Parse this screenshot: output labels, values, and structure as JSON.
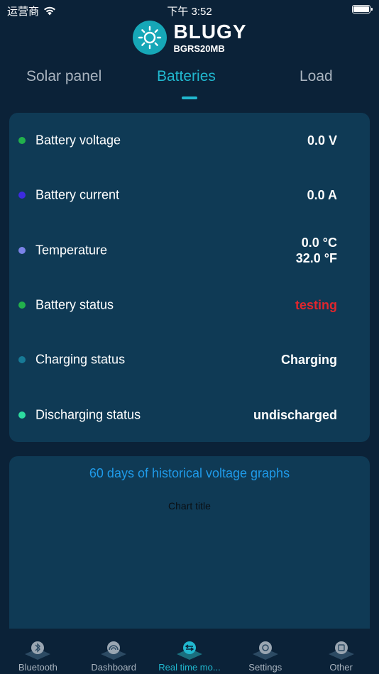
{
  "status_bar": {
    "carrier": "运营商",
    "time": "下午 3:52"
  },
  "brand": {
    "name": "BLUGY",
    "model": "BGRS20MB"
  },
  "tabs": [
    {
      "label": "Solar panel",
      "active": false
    },
    {
      "label": "Batteries",
      "active": true
    },
    {
      "label": "Load",
      "active": false
    }
  ],
  "metrics": [
    {
      "label": "Battery voltage",
      "value": "0.0 V",
      "dot_color": "#22b14c",
      "value_color": "#ffffff"
    },
    {
      "label": "Battery current",
      "value": "0.0 A",
      "dot_color": "#3d2be0",
      "value_color": "#ffffff"
    },
    {
      "label": "Temperature",
      "value": "0.0 °C",
      "value2": "32.0 °F",
      "dot_color": "#7b83e8",
      "value_color": "#ffffff"
    },
    {
      "label": "Battery status",
      "value": "testing",
      "dot_color": "#22b14c",
      "value_color": "#e0262d"
    },
    {
      "label": "Charging status",
      "value": "Charging",
      "dot_color": "#177a96",
      "value_color": "#ffffff"
    },
    {
      "label": "Discharging status",
      "value": "undischarged",
      "dot_color": "#2ddba0",
      "value_color": "#ffffff"
    }
  ],
  "history": {
    "title": "60 days of historical voltage graphs",
    "chart_title": "Chart title"
  },
  "tabbar": [
    {
      "label": "Bluetooth",
      "icon": "bluetooth-icon",
      "active": false
    },
    {
      "label": "Dashboard",
      "icon": "dashboard-icon",
      "active": false
    },
    {
      "label": "Real time mo...",
      "icon": "realtime-icon",
      "active": true
    },
    {
      "label": "Settings",
      "icon": "settings-icon",
      "active": false
    },
    {
      "label": "Other",
      "icon": "other-icon",
      "active": false
    }
  ],
  "colors": {
    "background": "#0b2238",
    "card": "#0f3a55",
    "accent": "#21b8cf",
    "link": "#1f9bea"
  }
}
